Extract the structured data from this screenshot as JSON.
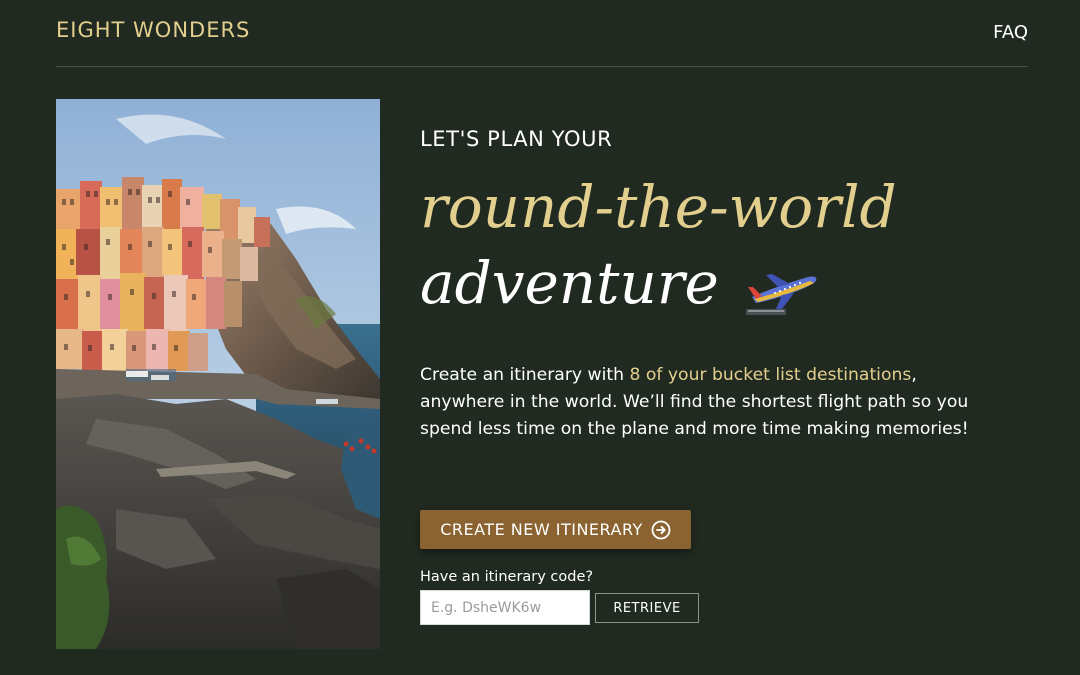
{
  "header": {
    "brand": "EIGHT WONDERS",
    "faq_label": "FAQ"
  },
  "hero": {
    "eyebrow": "LET'S PLAN YOUR",
    "headline_line1": "round-the-world",
    "headline_line2": "adventure",
    "plane_icon": "airplane-icon",
    "description_pre": "Create an itinerary with ",
    "description_highlight": "8 of your bucket list destinations",
    "description_post": ", anywhere in the world. We’ll find the shortest flight path so you spend less time on the plane and more time making memories!",
    "create_button": "CREATE NEW ITINERARY",
    "create_button_icon": "arrow-right-circle-icon",
    "code_label": "Have an itinerary code?",
    "code_placeholder": "E.g. DsheWK6w",
    "retrieve_button": "RETRIEVE"
  },
  "colors": {
    "background": "#212a21",
    "accent_gold": "#e2cf8e",
    "button_brown": "#8a6330"
  }
}
